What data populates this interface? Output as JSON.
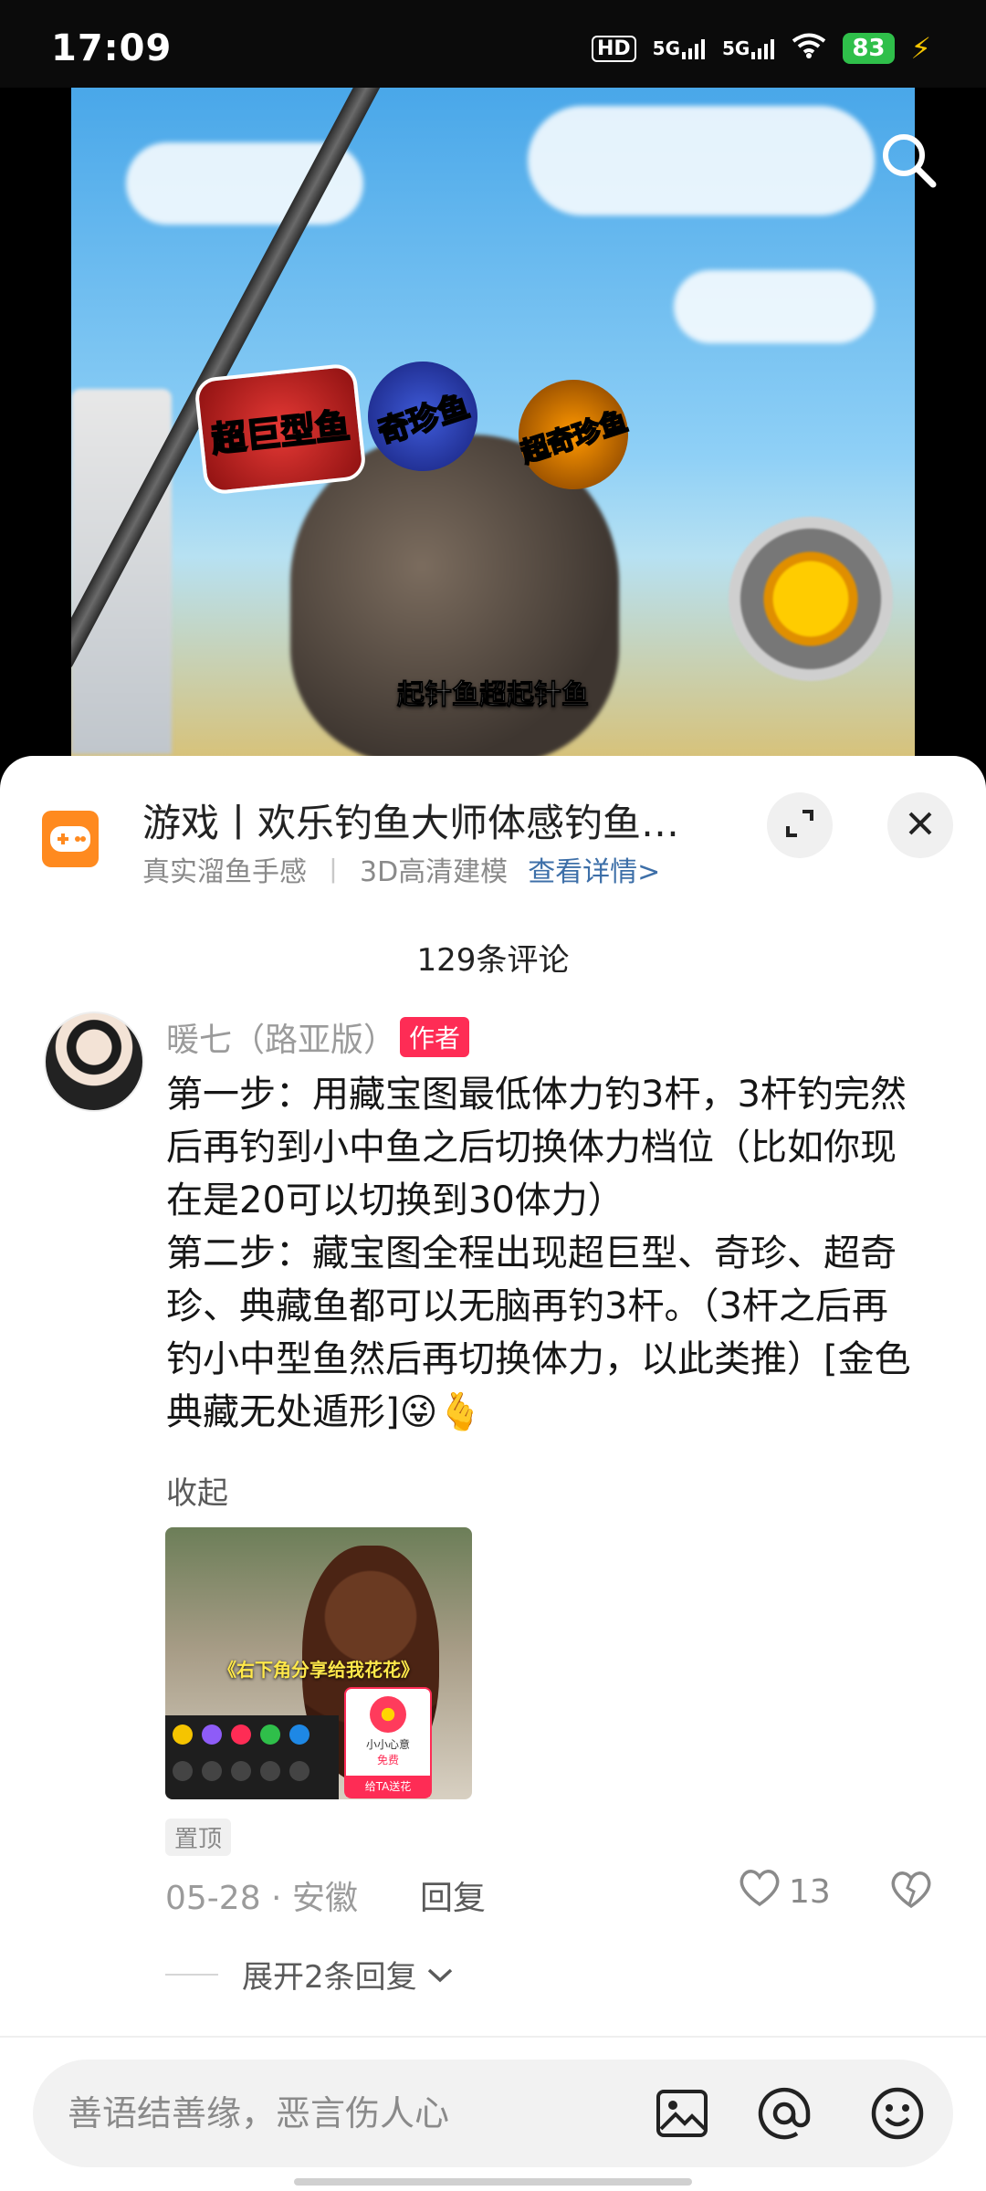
{
  "status_bar": {
    "time": "17:09",
    "hd_label": "HD",
    "signal1_label": "5G",
    "signal2_label": "5G",
    "battery": "83",
    "icons": [
      "hd-icon",
      "signal-5g-icon",
      "signal-5g-icon",
      "wifi-icon",
      "battery-icon",
      "charging-icon"
    ]
  },
  "video": {
    "badges": [
      "超巨型鱼",
      "奇珍鱼",
      "超奇珍鱼"
    ],
    "caption": "起针鱼超起针鱼",
    "search_icon": "search-icon"
  },
  "game_banner": {
    "title": "游戏丨欢乐钓鱼大师体感钓鱼…",
    "tag1": "真实溜鱼手感",
    "separator": "丨",
    "tag2": "3D高清建模",
    "link": "查看详情>",
    "icons": [
      "gamepad-icon",
      "expand-icon",
      "close-icon"
    ]
  },
  "comments": {
    "count_label": "129条评论"
  },
  "comment": {
    "username": "暖七（路亚版）",
    "author_tag": "作者",
    "text": "第一步：用藏宝图最低体力钓3杆，3杆钓完然后再钓到小中鱼之后切换体力档位（比如你现在是20可以切换到30体力）\n第二步：藏宝图全程出现超巨型、奇珍、超奇珍、典藏鱼都可以无脑再钓3杆。（3杆之后再钓小中型鱼然后再切换体力，以此类推）[金色典藏无处遁形]😜🫰",
    "collapse_label": "收起",
    "image": {
      "caption": "《右下角分享给我花花》",
      "card_title": "小小心意",
      "card_sub": "免费",
      "card_button": "给TA送花"
    },
    "pinned_label": "置顶",
    "date_location": "05-28 · 安徽",
    "reply_label": "回复",
    "like_count": "13",
    "expand_label": "展开2条回复"
  },
  "input_bar": {
    "placeholder": "善语结善缘，恶言伤人心",
    "icons": [
      "image-icon",
      "at-icon",
      "emoji-icon"
    ]
  },
  "colors": {
    "author_tag": "#fe2c55",
    "game_icon": "#ff8a1f",
    "link": "#3d6fa8",
    "battery": "#2fbf4a"
  }
}
